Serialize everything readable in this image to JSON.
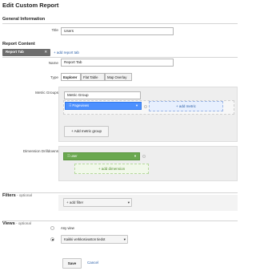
{
  "page": {
    "title": "Edit Custom Report",
    "general_info_heading": "General Information",
    "title_label": "Title",
    "title_value": "Users",
    "report_content_heading": "Report Content",
    "report_tab_chip": "Report Tab",
    "add_report_tab": "+ add report tab",
    "name_label": "Name",
    "name_value": "Report Tab",
    "type_label": "Type",
    "type_options": [
      "Explorer",
      "Flat Table",
      "Map Overlay"
    ],
    "type_selected": "Explorer",
    "metric_groups_label": "Metric Groups",
    "metric_group_name": "Metric Group",
    "metric_chip": "Pageviews",
    "add_metric": "+ add metric",
    "add_metric_group": "+ Add metric group",
    "dimension_drilldowns_label": "Dimension Drilldowns",
    "dimension_chip": "user",
    "add_dimension": "+ add dimension",
    "filters_heading": "Filters",
    "filters_optional": " - optional",
    "add_filter": "+ add filter",
    "views_heading": "Views",
    "views_optional": " - optional",
    "view_options": [
      "Any view",
      "Kaikki verkkosivuston tiedot"
    ],
    "view_selected": "Kaikki verkkosivuston tiedot",
    "save_label": "Save",
    "cancel_label": "Cancel"
  },
  "colors": {
    "accent_blue": "#4d90fe",
    "accent_green": "#6aa84f",
    "link": "#2a5ea8"
  }
}
